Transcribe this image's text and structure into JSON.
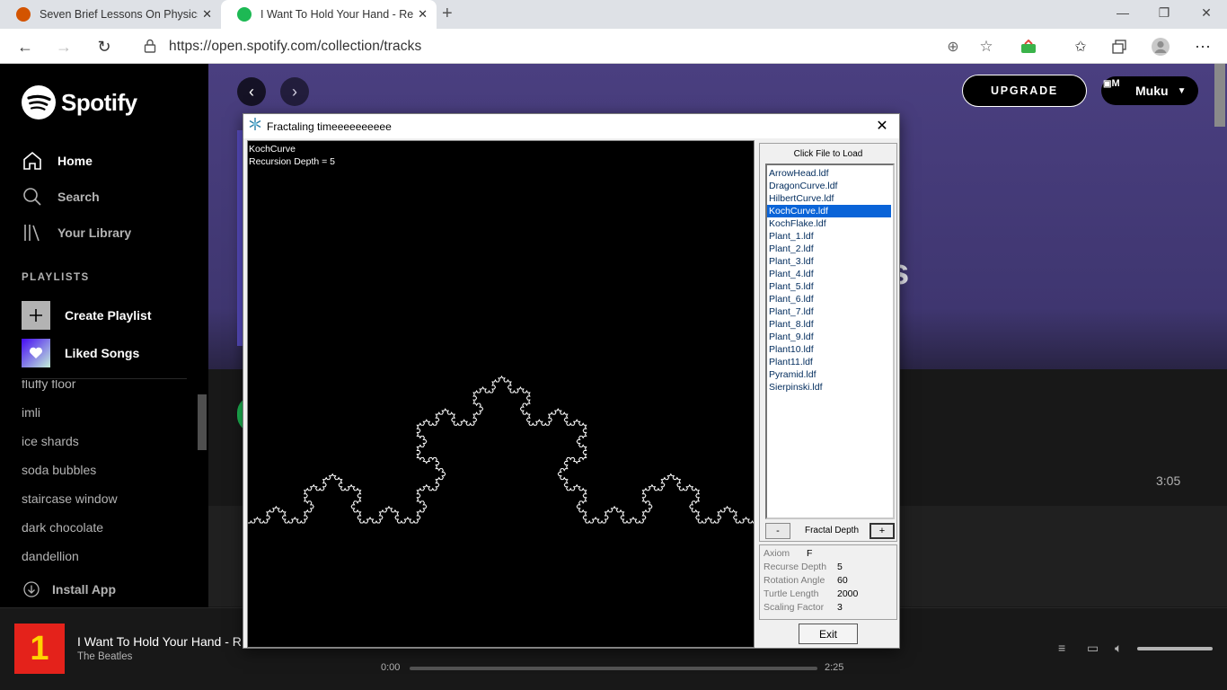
{
  "browser": {
    "tabs": [
      {
        "title": "Seven Brief Lessons On Physics -",
        "favicon_color": "#d35400"
      },
      {
        "title": "I Want To Hold Your Hand - Rem",
        "favicon_color": "#1db954"
      }
    ],
    "url": "https://open.spotify.com/collection/tracks"
  },
  "spotify": {
    "logo_text": "Spotify",
    "nav": {
      "home": "Home",
      "search": "Search",
      "library": "Your Library"
    },
    "playlists_heading": "PLAYLISTS",
    "create_playlist": "Create Playlist",
    "liked_songs": "Liked Songs",
    "playlist_items": [
      "fluffy floor",
      "imli",
      "ice shards",
      "soda bubbles",
      "staircase window",
      "dark chocolate",
      "dandellion"
    ],
    "install_app": "Install App",
    "upgrade": "UPGRADE",
    "user_avatar_alt": "M",
    "user_name": "Muku",
    "track_duration": "3:05",
    "big_letter": "s"
  },
  "player": {
    "title": "I Want To Hold Your Hand - R",
    "artist": "The Beatles",
    "art_label": "1",
    "time_current": "0:00",
    "time_total": "2:25",
    "progress": 0
  },
  "fractal_window": {
    "title": "Fractaling timeeeeeeeeee",
    "canvas_name": "KochCurve",
    "canvas_depth": "Recursion Depth = 5",
    "panel_title": "Click File to Load",
    "files": [
      "ArrowHead.ldf",
      "DragonCurve.ldf",
      "HilbertCurve.ldf",
      "KochCurve.ldf",
      "KochFlake.ldf",
      "Plant_1.ldf",
      "Plant_2.ldf",
      "Plant_3.ldf",
      "Plant_4.ldf",
      "Plant_5.ldf",
      "Plant_6.ldf",
      "Plant_7.ldf",
      "Plant_8.ldf",
      "Plant_9.ldf",
      "Plant10.ldf",
      "Plant11.ldf",
      "Pyramid.ldf",
      "Sierpinski.ldf"
    ],
    "selected_file": "KochCurve.ldf",
    "depth_minus": "-",
    "depth_label": "Fractal Depth",
    "depth_plus": "+",
    "params": [
      {
        "label": "Axiom",
        "value": "F"
      },
      {
        "label": "Recurse Depth",
        "value": "5"
      },
      {
        "label": "Rotation Angle",
        "value": "60"
      },
      {
        "label": "Turtle Length",
        "value": "2000"
      },
      {
        "label": "Scaling Factor",
        "value": "3"
      }
    ],
    "exit": "Exit"
  },
  "colors": {
    "spotify_green": "#1db954",
    "selection_blue": "#0a64d8"
  }
}
